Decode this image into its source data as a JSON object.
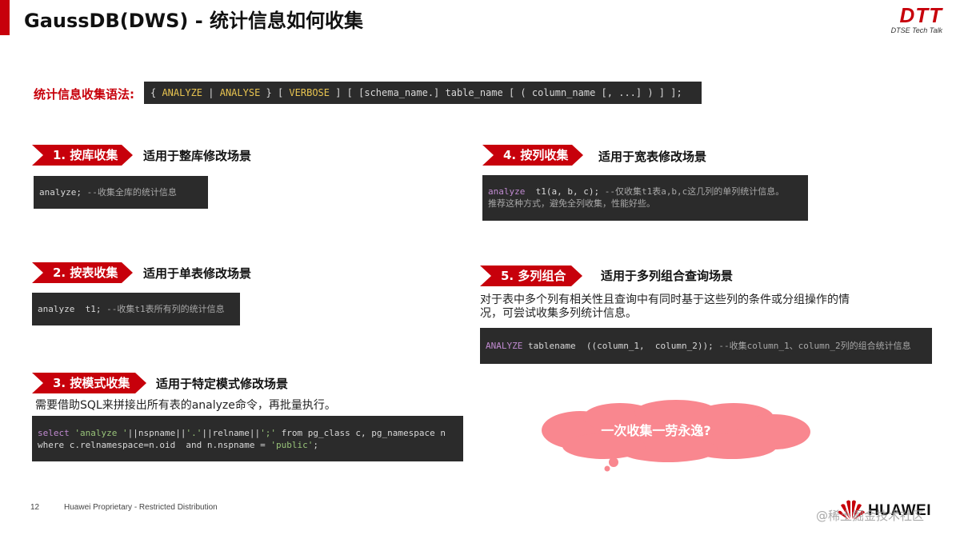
{
  "header": {
    "title": "GaussDB(DWS) - 统计信息如何收集",
    "logo_main": "DTT",
    "logo_sub": "DTSE Tech Talk"
  },
  "syntax": {
    "label": "统计信息收集语法:",
    "p1": "{ ",
    "k1": "ANALYZE",
    "p2": " | ",
    "k2": "ANALYSE",
    "p3": " } [ ",
    "k3": "VERBOSE",
    "p4": " ] [ [schema_name.] table_name [ ( column_name [, ...] ) ] ];"
  },
  "sections": {
    "s1": {
      "badge": "1. 按库收集",
      "desc": "适用于整库修改场景",
      "code": "analyze;",
      "comment": " --收集全库的统计信息"
    },
    "s2": {
      "badge": "2. 按表收集",
      "desc": "适用于单表修改场景",
      "code": "analyze  t1;",
      "comment": " --收集t1表所有列的统计信息"
    },
    "s3": {
      "badge": "3. 按模式收集",
      "desc": "适用于特定模式修改场景",
      "note": "需要借助SQL来拼接出所有表的analyze命令，再批量执行。",
      "l1a": "select ",
      "l1b": "'analyze '",
      "l1c": "||nspname||",
      "l1d": "'.'",
      "l1e": "||relname||",
      "l1f": "';'",
      "l1g": " from pg_class c, pg_namespace n",
      "l2a": "where c.relnamespace=n.oid  and n.nspname = ",
      "l2b": "'public'",
      "l2c": ";"
    },
    "s4": {
      "badge": "4. 按列收集",
      "desc": "适用于宽表修改场景",
      "code_kw": "analyze",
      "code": "  t1(a, b, c);",
      "comment1": " --仅收集t1表a,b,c这几列的单列统计信息。",
      "comment2": "推荐这种方式，避免全列收集，性能好些。"
    },
    "s5": {
      "badge": "5. 多列组合",
      "desc": "适用于多列组合查询场景",
      "note1": "对于表中多个列有相关性且查询中有同时基于这些列的条件或分组操作的情",
      "note2": "况，可尝试收集多列统计信息。",
      "code_kw": "ANALYZE",
      "code": " tablename  ((column_1,  column_2));",
      "comment": " --收集column_1、column_2列的组合统计信息"
    }
  },
  "callout": {
    "text": "一次收集一劳永逸?"
  },
  "footer": {
    "page_number": "12",
    "text": "Huawei Proprietary - Restricted Distribution",
    "brand": "HUAWEI",
    "watermark": "@稀土掘金技术社区"
  },
  "colors": {
    "accent": "#c7000b",
    "code_bg": "#2b2b2b",
    "cloud": "#f9878f"
  }
}
